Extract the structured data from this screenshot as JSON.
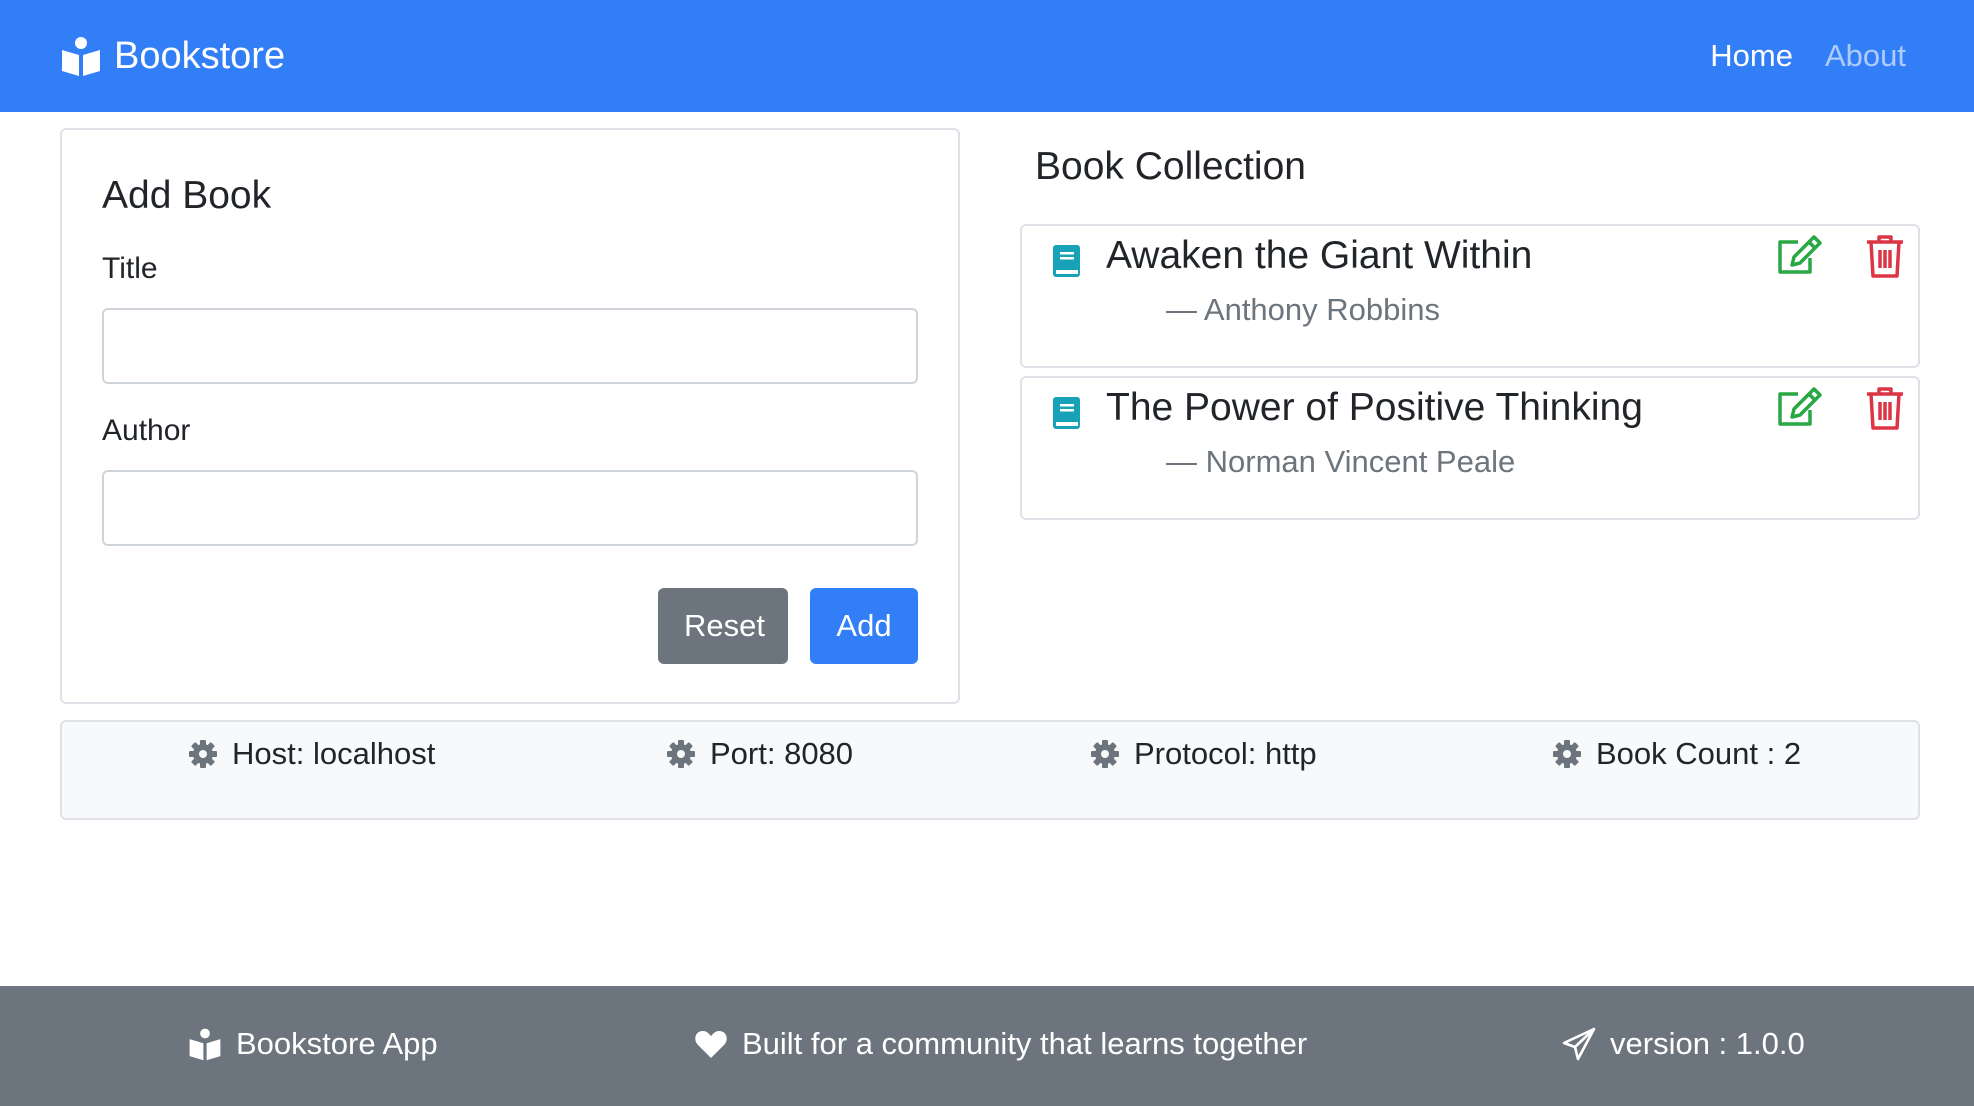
{
  "navbar": {
    "brand_icon": "open-book-reader-icon",
    "brand": "Bookstore",
    "links": [
      {
        "label": "Home",
        "active": true
      },
      {
        "label": "About",
        "active": false
      }
    ]
  },
  "add_form": {
    "heading": "Add Book",
    "title_label": "Title",
    "title_value": "",
    "author_label": "Author",
    "author_value": "",
    "reset_label": "Reset",
    "add_label": "Add"
  },
  "collection": {
    "heading": "Book Collection",
    "books": [
      {
        "title": "Awaken the Giant Within",
        "author": "— Anthony Robbins"
      },
      {
        "title": "The Power of Positive Thinking",
        "author": "— Norman Vincent Peale"
      }
    ],
    "book_icon": "book-icon",
    "edit_icon": "edit-icon",
    "delete_icon": "trash-icon"
  },
  "info": {
    "icon": "cog-icon",
    "host": "Host: localhost",
    "port": "Port: 8080",
    "protocol": "Protocol: http",
    "count": "Book Count : 2"
  },
  "footer": {
    "app_name": "Bookstore App",
    "tagline": "Built for a community that learns together",
    "version": "version : 1.0.0"
  },
  "colors": {
    "primary": "#327ef7",
    "secondary": "#6c757d",
    "success": "#28a745",
    "danger": "#dc3545",
    "info": "#17a2b8",
    "light": "#f8f9fa"
  }
}
